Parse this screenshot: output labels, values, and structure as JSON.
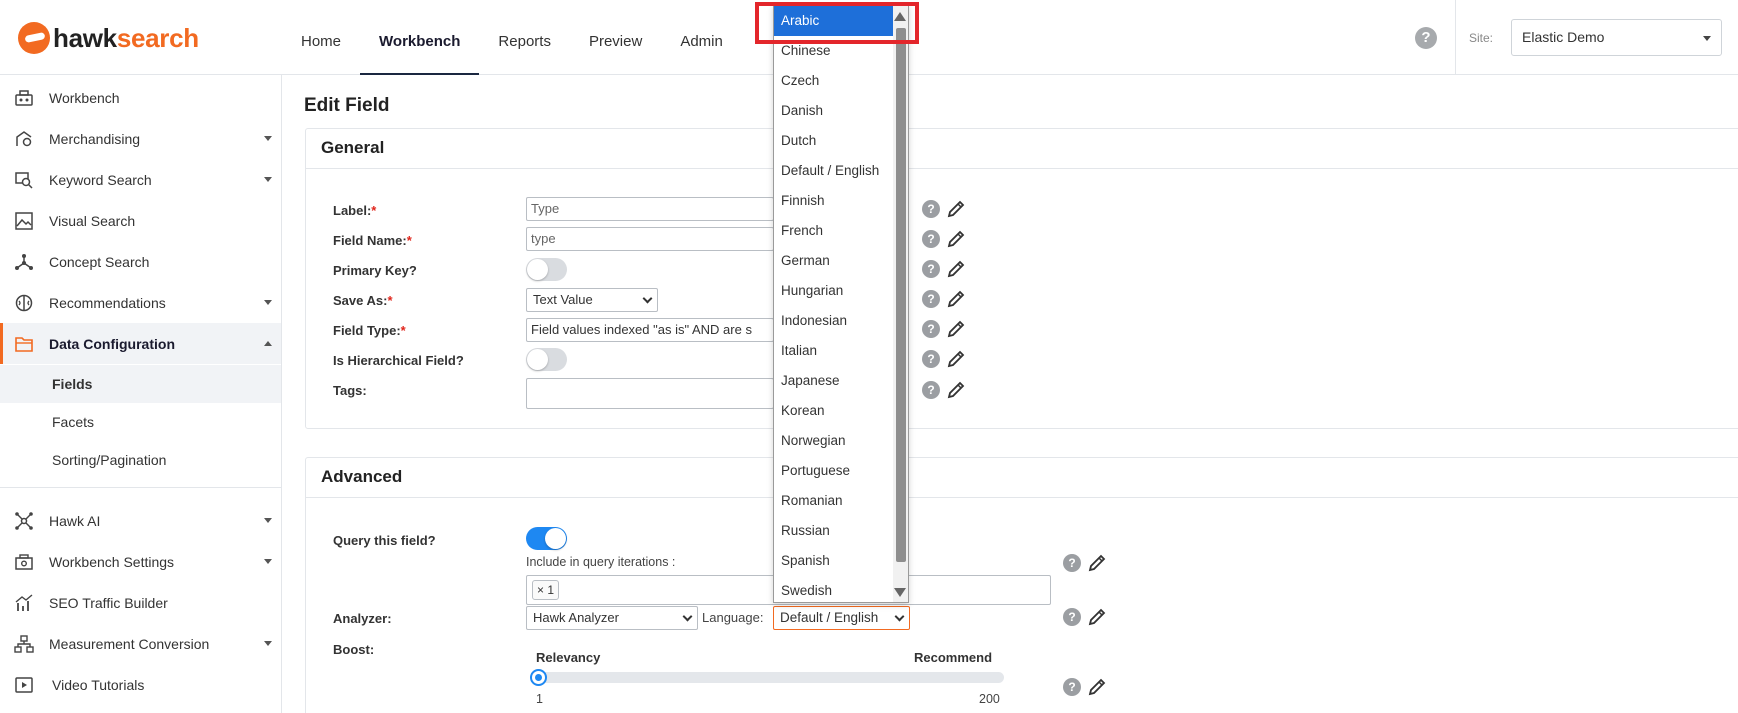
{
  "brand": {
    "part1": "hawk",
    "part2": "search",
    "accent": "#f26a21"
  },
  "topnav": [
    "Home",
    "Workbench",
    "Reports",
    "Preview",
    "Admin"
  ],
  "header": {
    "help": "?",
    "site_label": "Site:",
    "site_value": "Elastic Demo"
  },
  "sidebar": {
    "items": [
      {
        "label": "Workbench",
        "icon": "workbench-icon"
      },
      {
        "label": "Merchandising",
        "icon": "merchandising-icon"
      },
      {
        "label": "Keyword Search",
        "icon": "keyword-search-icon"
      },
      {
        "label": "Visual Search",
        "icon": "image-icon"
      },
      {
        "label": "Concept Search",
        "icon": "concept-icon"
      },
      {
        "label": "Recommendations",
        "icon": "brain-icon"
      },
      {
        "label": "Data Configuration",
        "icon": "folder-icon"
      },
      {
        "label": "Hawk AI",
        "icon": "ai-network-icon"
      },
      {
        "label": "Workbench Settings",
        "icon": "settings-icon"
      },
      {
        "label": "SEO Traffic Builder",
        "icon": "seo-icon"
      },
      {
        "label": "Measurement Conversion",
        "icon": "measurement-icon"
      },
      {
        "label": "Video Tutorials",
        "icon": "video-icon"
      }
    ],
    "sub": [
      "Fields",
      "Facets",
      "Sorting/Pagination"
    ]
  },
  "page_title": "Edit Field",
  "general": {
    "title": "General",
    "label_label": "Label:",
    "label_value": "Type",
    "fieldname_label": "Field Name:",
    "fieldname_value": "type",
    "primary_key_label": "Primary Key?",
    "save_as_label": "Save As:",
    "save_as_value": "Text Value",
    "field_type_label": "Field Type:",
    "field_type_value": "Field values indexed \"as is\" AND are s",
    "hier_label": "Is Hierarchical Field?",
    "tags_label": "Tags:",
    "req": "*"
  },
  "advanced": {
    "title": "Advanced",
    "query_label": "Query this field?",
    "include_label": "Include in query iterations :",
    "iteration_tag": "1",
    "iteration_tag_remove": "×",
    "analyzer_label": "Analyzer:",
    "analyzer_value": "Hawk Analyzer",
    "language_label": "Language:",
    "language_value": "Default / English",
    "boost_label": "Boost:",
    "relevancy": "Relevancy",
    "recommend": "Recommend",
    "min": "1",
    "max": "200",
    "boost_value": 1
  },
  "language_options": [
    "Arabic",
    "Chinese",
    "Czech",
    "Danish",
    "Dutch",
    "Default / English",
    "Finnish",
    "French",
    "German",
    "Hungarian",
    "Indonesian",
    "Italian",
    "Japanese",
    "Korean",
    "Norwegian",
    "Portuguese",
    "Romanian",
    "Russian",
    "Spanish",
    "Swedish"
  ],
  "colors": {
    "accent": "#f26a21",
    "selection": "#1e6fd9",
    "toggle_on": "#1e88f2",
    "highlight": "#e3262b"
  }
}
